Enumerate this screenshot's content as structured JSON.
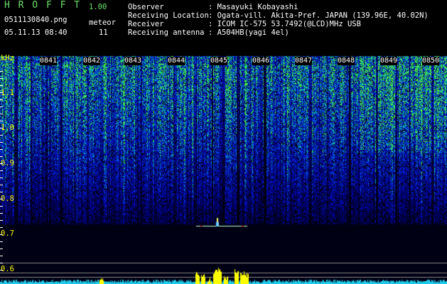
{
  "app": {
    "name": "H R O F F T",
    "version": "1.00"
  },
  "file": {
    "name": "0511130840.png",
    "datetime": "05.11.13 08:40"
  },
  "meteor": {
    "label": "meteor",
    "count": "11"
  },
  "info": {
    "observer_label": "Observer",
    "observer_value": ": Masayuki Kobayashi",
    "location_label": "Receiving Location",
    "location_value": ": Ogata-vill. Akita-Pref. JAPAN (139.96E, 40.02N)",
    "receiver_label": "Receiver",
    "receiver_value": ": ICOM IC-575 53.7492(@LCD)MHz USB",
    "antenna_label": "Receiving antenna",
    "antenna_value": ": A504HB(yagi 4el)"
  },
  "spectrogram": {
    "unit": "kHz",
    "freq_ticks": [
      "1.1",
      "1.0",
      "0.9",
      "0.8",
      "0.7",
      "0.6"
    ],
    "time_ticks": [
      "0841",
      "0842",
      "0843",
      "0844",
      "0845",
      "0846",
      "0847",
      "0848",
      "0849",
      "0850"
    ]
  },
  "colors": {
    "title_green": "#6de26d",
    "label_yellow": "#ffff00"
  }
}
